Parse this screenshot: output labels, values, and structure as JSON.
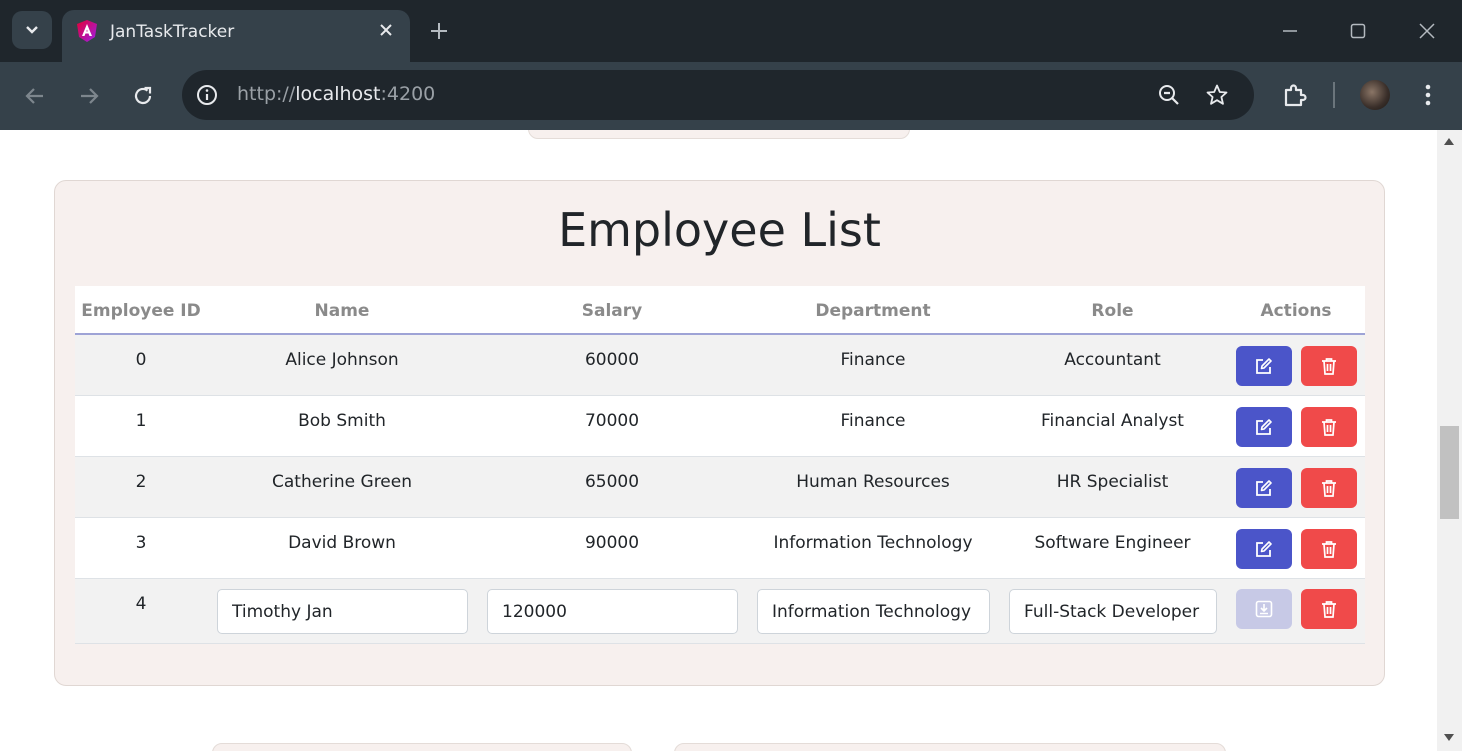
{
  "browser": {
    "tab_title": "JanTaskTracker",
    "url_scheme": "http://",
    "url_host": "localhost",
    "url_port": ":4200"
  },
  "page": {
    "title": "Employee List",
    "columns": [
      "Employee ID",
      "Name",
      "Salary",
      "Department",
      "Role",
      "Actions"
    ],
    "rows": [
      {
        "id": "0",
        "name": "Alice Johnson",
        "salary": "60000",
        "department": "Finance",
        "role": "Accountant"
      },
      {
        "id": "1",
        "name": "Bob Smith",
        "salary": "70000",
        "department": "Finance",
        "role": "Financial Analyst"
      },
      {
        "id": "2",
        "name": "Catherine Green",
        "salary": "65000",
        "department": "Human Resources",
        "role": "HR Specialist"
      },
      {
        "id": "3",
        "name": "David Brown",
        "salary": "90000",
        "department": "Information Technology",
        "role": "Software Engineer"
      }
    ],
    "editing_row": {
      "id": "4",
      "name": "Timothy Jan",
      "salary": "120000",
      "department": "Information Technology",
      "role": "Full-Stack Developer"
    }
  },
  "colors": {
    "edit_button": "#4b55c9",
    "delete_button": "#f04a4a",
    "save_button_disabled": "#c7c9e6",
    "card_background": "#f7f0ee"
  },
  "icons": {
    "edit": "edit-icon",
    "delete": "trash-icon",
    "save": "save-icon"
  }
}
